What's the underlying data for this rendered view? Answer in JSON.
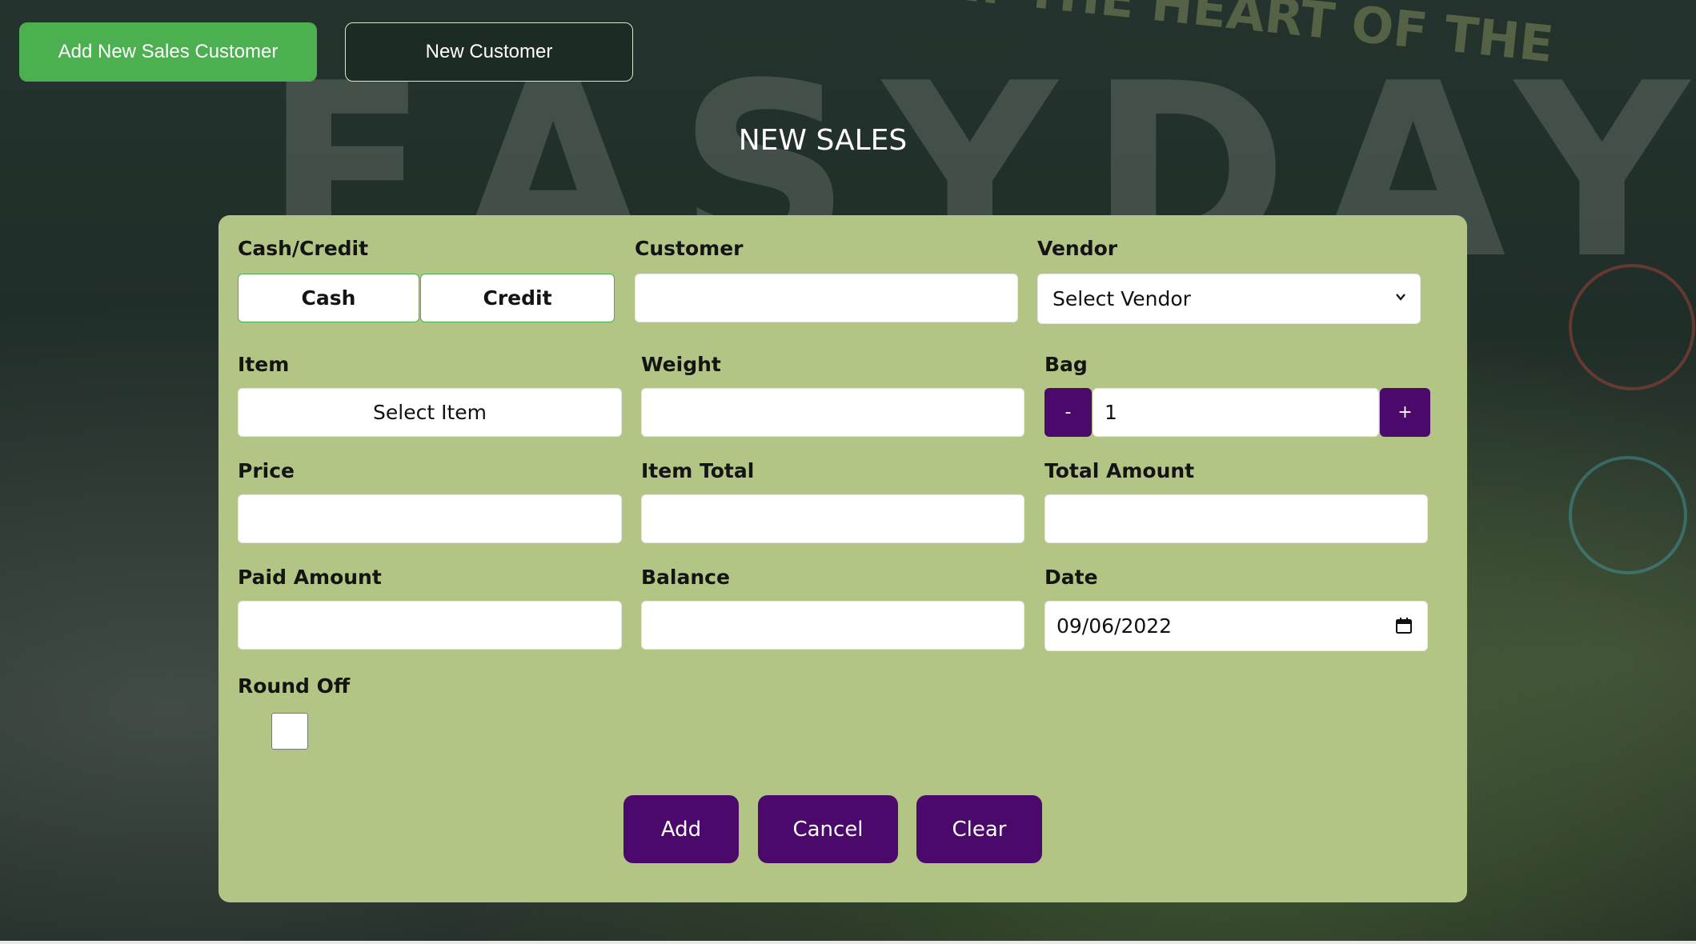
{
  "header": {
    "add_new_sales_customer": "Add New Sales Customer",
    "new_customer": "New Customer"
  },
  "page_title": "NEW SALES",
  "form": {
    "cash_credit": {
      "label": "Cash/Credit",
      "cash": "Cash",
      "credit": "Credit"
    },
    "customer": {
      "label": "Customer",
      "value": ""
    },
    "vendor": {
      "label": "Vendor",
      "selected": "Select Vendor"
    },
    "item": {
      "label": "Item",
      "selected": "Select Item"
    },
    "weight": {
      "label": "Weight",
      "value": ""
    },
    "bag": {
      "label": "Bag",
      "minus": "-",
      "value": "1",
      "plus": "+"
    },
    "price": {
      "label": "Price",
      "value": ""
    },
    "item_total": {
      "label": "Item Total",
      "value": ""
    },
    "total_amount": {
      "label": "Total Amount",
      "value": ""
    },
    "paid_amount": {
      "label": "Paid Amount",
      "value": ""
    },
    "balance": {
      "label": "Balance",
      "value": ""
    },
    "date": {
      "label": "Date",
      "value": "09/06/2022"
    },
    "round_off": {
      "label": "Round Off",
      "checked": false
    }
  },
  "actions": {
    "add": "Add",
    "cancel": "Cancel",
    "clear": "Clear"
  },
  "colors": {
    "primary_green": "#4caf50",
    "panel": "#b2c585",
    "accent_purple": "#4b0a6b",
    "dark_background": "#1d2b25"
  },
  "background": {
    "brand_text": "EASYDAY",
    "slogan": "…RE AT THE HEART OF THE"
  }
}
